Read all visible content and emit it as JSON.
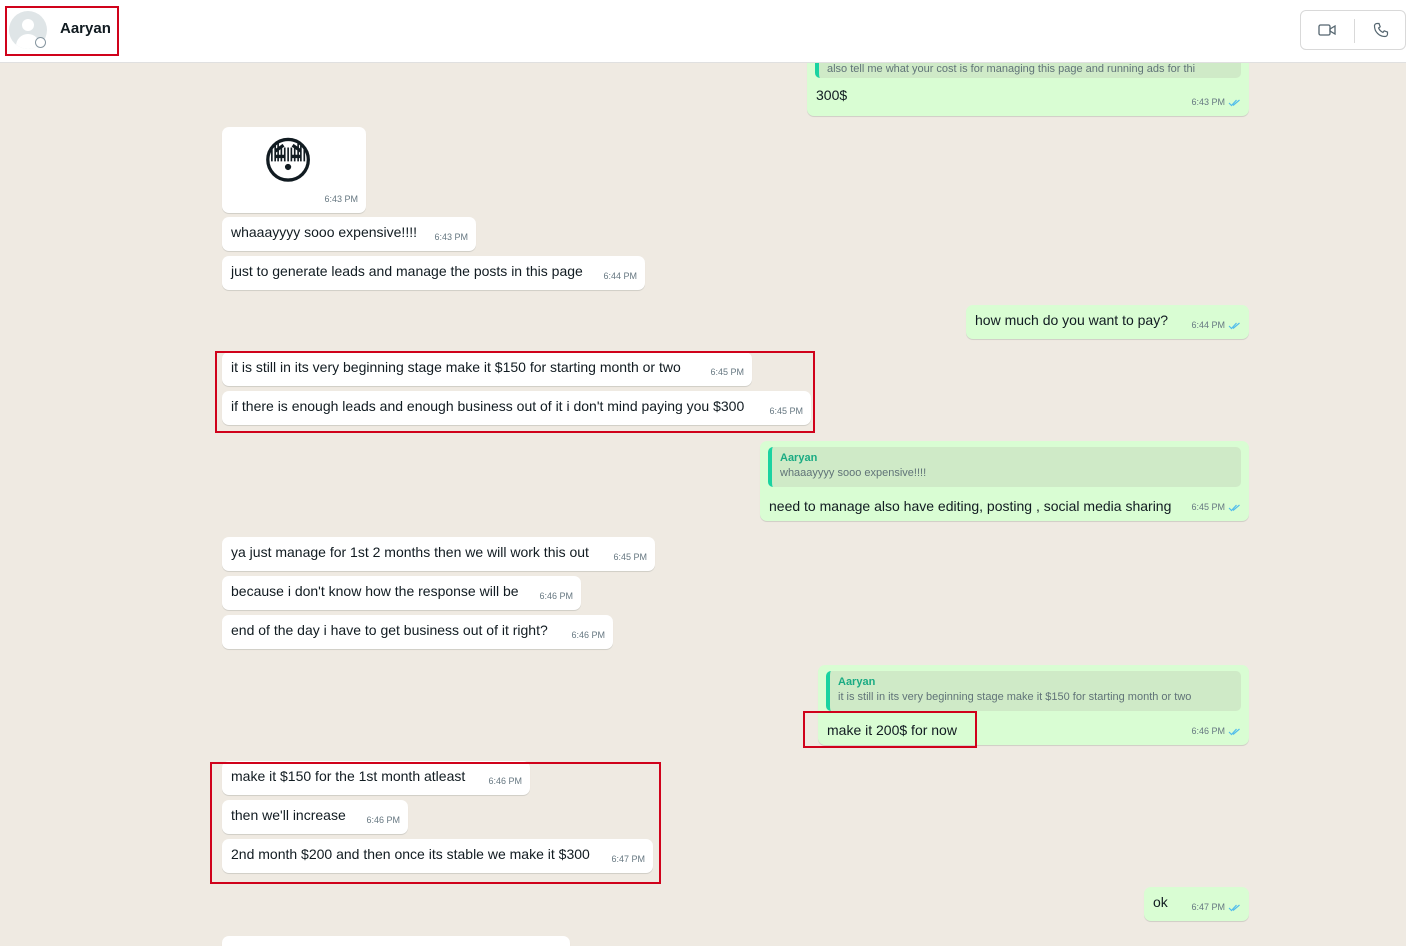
{
  "header": {
    "contact_name": "Aaryan",
    "icons": {
      "avatar": "default-avatar",
      "status": "status-ring-icon",
      "video": "video-call-icon",
      "voice": "voice-call-icon"
    }
  },
  "colors": {
    "chat_background": "#efeae2",
    "incoming_bubble": "#ffffff",
    "outgoing_bubble": "#d9fdd3",
    "read_tick": "#53bdeb",
    "highlight_box": "#d0021b"
  },
  "messages": [
    {
      "dir": "out",
      "quote": {
        "author": "",
        "text": "also tell me what your cost is for managing this page and running ads for thi"
      },
      "text": "300$",
      "time": "6:43 PM",
      "read": true
    },
    {
      "dir": "in",
      "type": "sticker",
      "emoji": "😳",
      "time": "6:43 PM"
    },
    {
      "dir": "in",
      "text": "whaaayyyy sooo expensive!!!!",
      "time": "6:43 PM"
    },
    {
      "dir": "in",
      "text": "just to generate leads and manage the posts in this page",
      "time": "6:44 PM"
    },
    {
      "dir": "out",
      "text": "how much do you want to pay?",
      "time": "6:44 PM",
      "read": true
    },
    {
      "dir": "in",
      "text": "it is still in its very beginning stage make it $150 for starting month or two",
      "time": "6:45 PM"
    },
    {
      "dir": "in",
      "text": "if there is enough leads and enough business out of it i don't mind paying you $300",
      "time": "6:45 PM"
    },
    {
      "dir": "out",
      "quote": {
        "author": "Aaryan",
        "text": "whaaayyyy sooo expensive!!!!"
      },
      "text": "need to manage also have editing, posting , social media sharing",
      "time": "6:45 PM",
      "read": true
    },
    {
      "dir": "in",
      "text": "ya just manage for 1st 2 months then we will work this out",
      "time": "6:45 PM"
    },
    {
      "dir": "in",
      "text": "because i don't know how the response will be",
      "time": "6:46 PM"
    },
    {
      "dir": "in",
      "text": "end of the day i have to get business out of it right?",
      "time": "6:46 PM"
    },
    {
      "dir": "out",
      "quote": {
        "author": "Aaryan",
        "text": "it is still in its very beginning stage make it $150 for starting month or two"
      },
      "text": "make it 200$ for now",
      "time": "6:46 PM",
      "read": true
    },
    {
      "dir": "in",
      "text": "make it $150 for the 1st month atleast",
      "time": "6:46 PM"
    },
    {
      "dir": "in",
      "text": "then we'll increase",
      "time": "6:46 PM"
    },
    {
      "dir": "in",
      "text": "2nd month $200 and then once its stable we make it $300",
      "time": "6:47 PM"
    },
    {
      "dir": "out",
      "text": "ok",
      "time": "6:47 PM",
      "read": true
    }
  ]
}
